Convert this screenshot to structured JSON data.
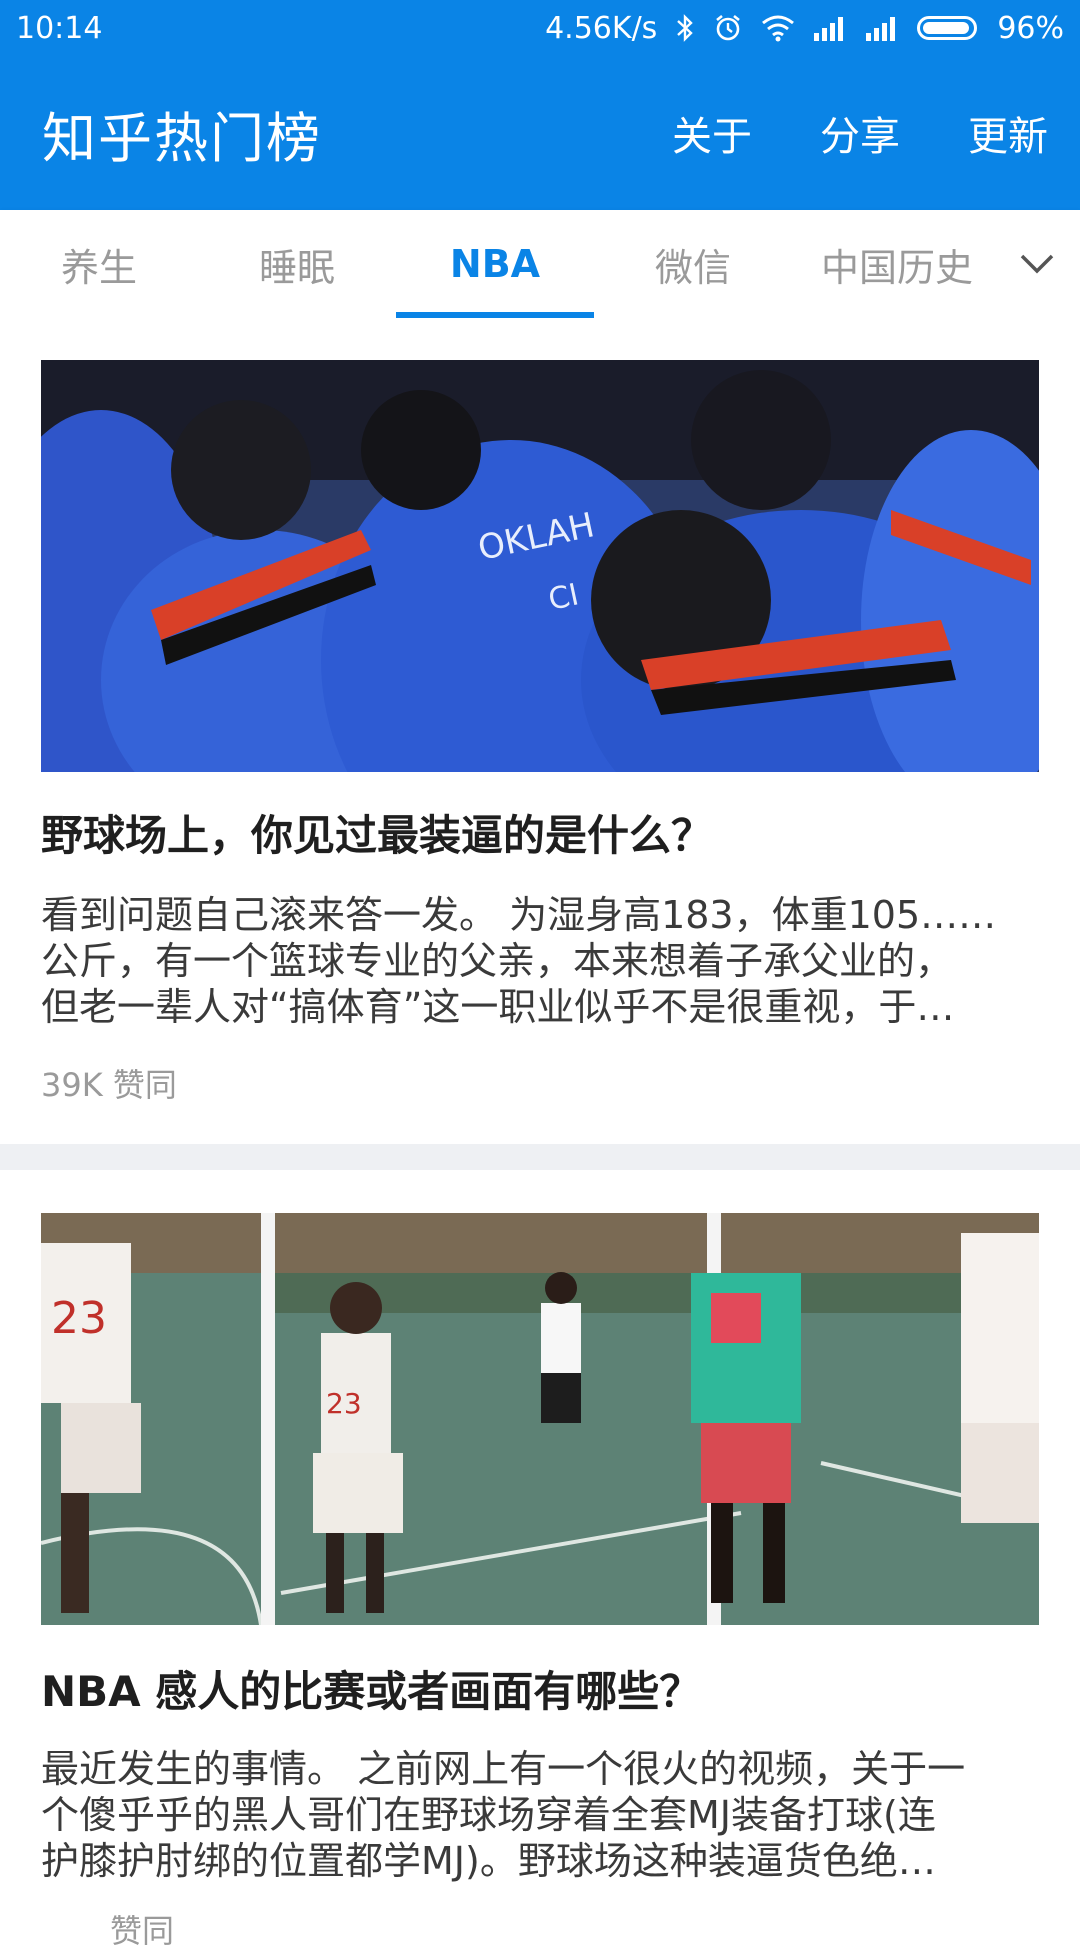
{
  "status_bar": {
    "time": "10:14",
    "network_speed": "4.56K/s",
    "battery_percent": "96%",
    "battery_level": 0.96,
    "icons": [
      "bluetooth-icon",
      "alarm-icon",
      "wifi-icon",
      "signal-icon",
      "signal-icon",
      "battery-icon"
    ]
  },
  "app_bar": {
    "title": "知乎热门榜",
    "actions": {
      "about": "关于",
      "share": "分享",
      "refresh": "更新"
    }
  },
  "tabs": {
    "items": [
      {
        "label": "养生",
        "active": false
      },
      {
        "label": "睡眠",
        "active": false
      },
      {
        "label": "NBA",
        "active": true
      },
      {
        "label": "微信",
        "active": false
      },
      {
        "label": "中国历史",
        "active": false
      }
    ],
    "more_icon": "chevron-down-icon"
  },
  "feed": [
    {
      "title": "野球场上，你见过最装逼的是什么？",
      "excerpt_lines": [
        "看到问题自己滚来答一发。 为湿身高183，体重105……",
        "公斤，有一个篮球专业的父亲，本来想着子承父业的，",
        "但老一辈人对“搞体育”这一职业似乎不是很重视，于…"
      ],
      "votes": "39K 赞同",
      "image": "team-huddle-photo"
    },
    {
      "title": "NBA 感人的比赛或者画面有哪些？",
      "excerpt_lines": [
        "最近发生的事情。 之前网上有一个很火的视频，关于一",
        "个傻乎乎的黑人哥们在野球场穿着全套MJ装备打球(连",
        "护膝护肘绑的位置都学MJ)。野球场这种装逼货色绝…"
      ],
      "votes": "赞同",
      "image": "streetball-collage-photo"
    }
  ],
  "colors": {
    "primary": "#0a84e6",
    "tab_inactive": "#9a9a9a",
    "separator": "#eef0f3"
  }
}
